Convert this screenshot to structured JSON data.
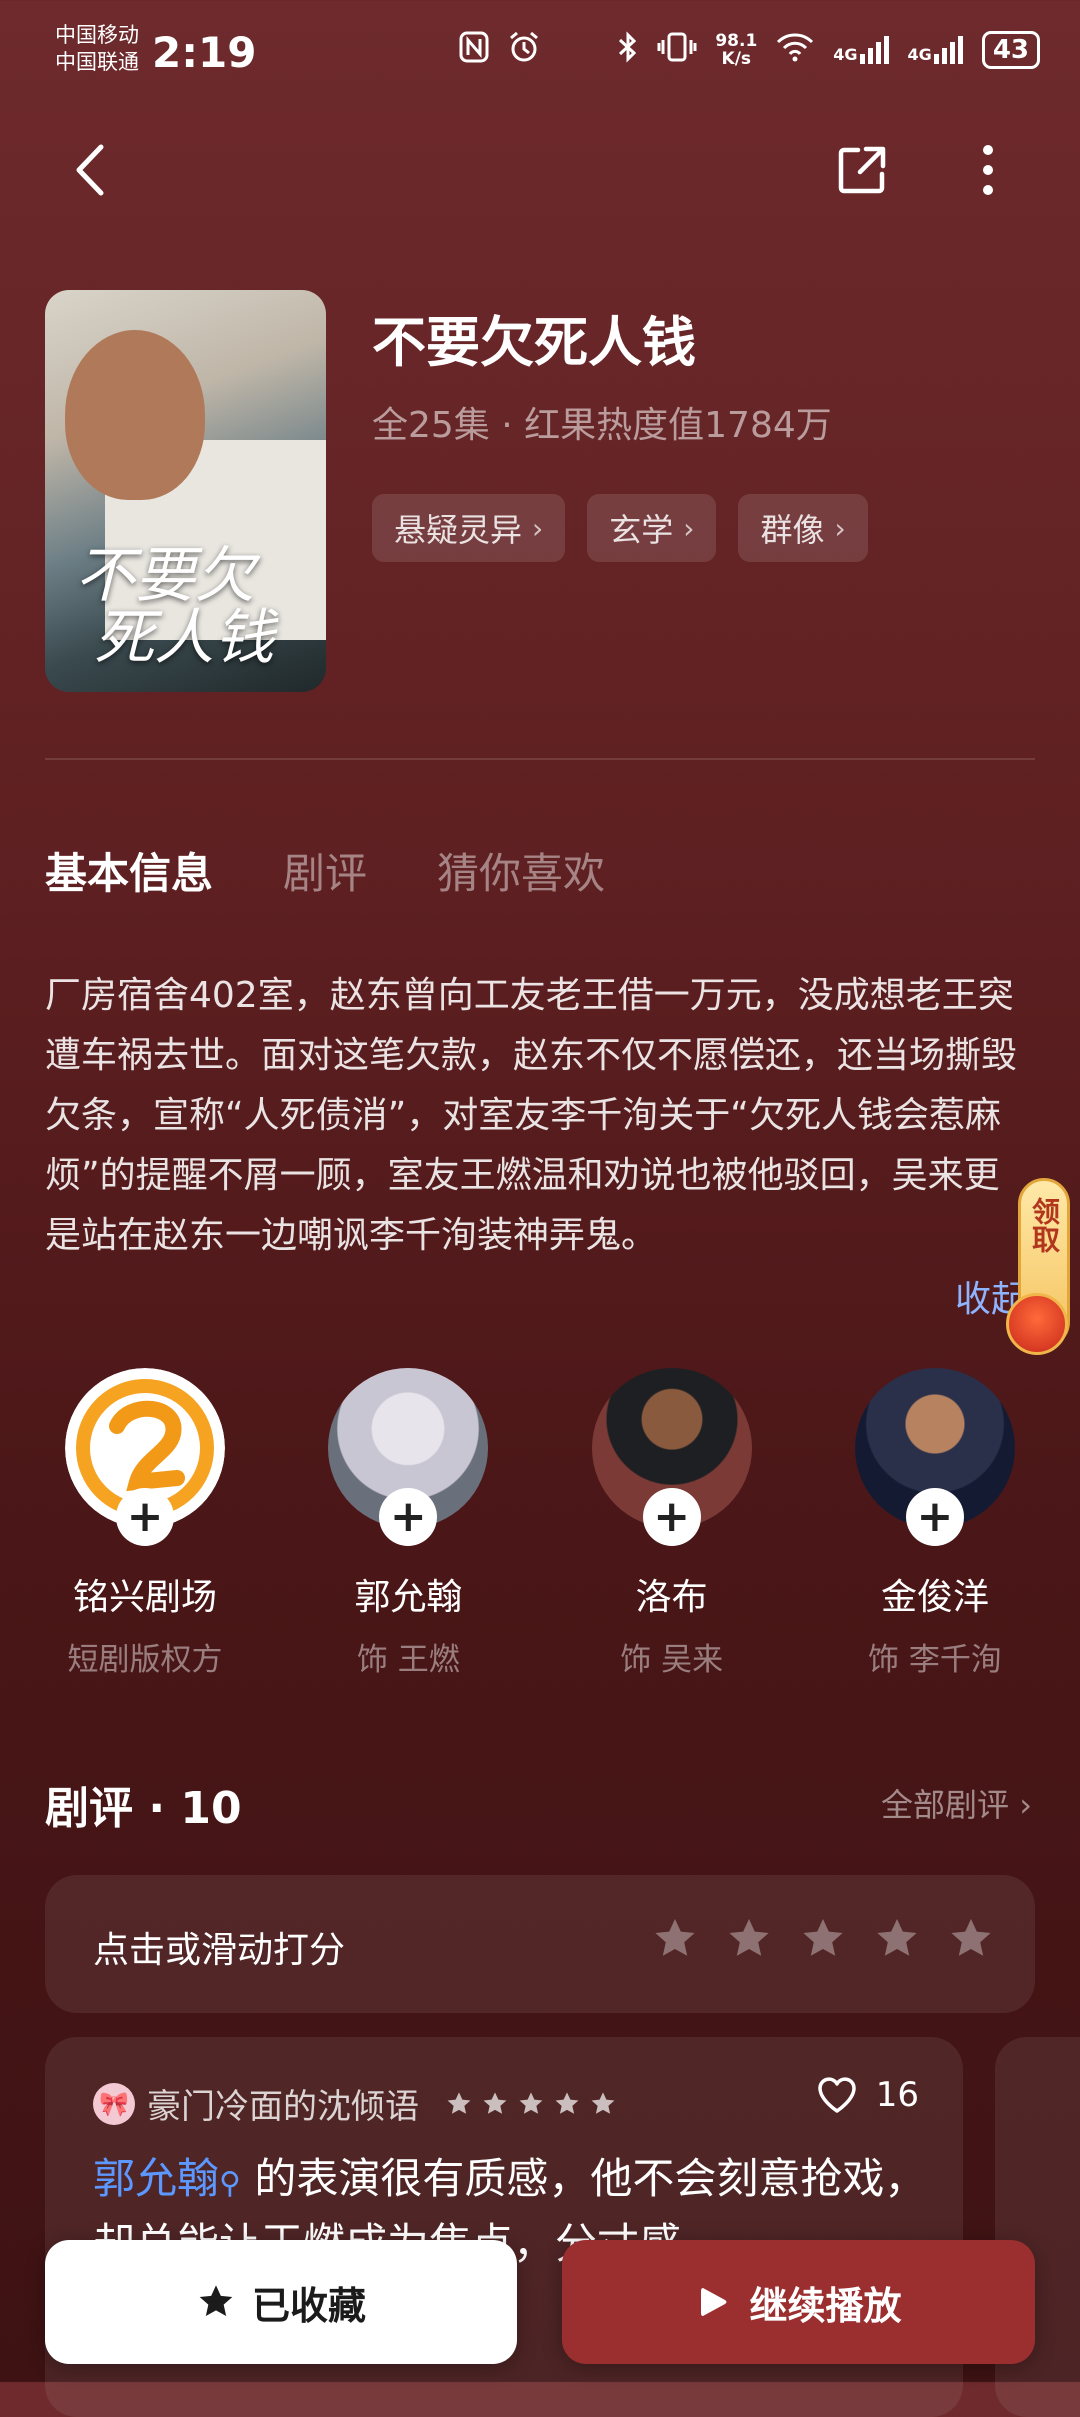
{
  "status_bar": {
    "carrier1": "中国移动",
    "carrier2": "中国联通",
    "time": "2:19",
    "speed_top": "98.1",
    "speed_unit": "K/s",
    "net1": "4G",
    "net2": "4G",
    "battery": "43"
  },
  "header": {
    "title": "不要欠死人钱",
    "poster_title": "不要欠\n死人钱",
    "episodes": "全25集",
    "heat": "红果热度值1784万",
    "tags": [
      "悬疑灵异",
      "玄学",
      "群像"
    ]
  },
  "tabs": [
    "基本信息",
    "剧评",
    "猜你喜欢"
  ],
  "synopsis": "厂房宿舍402室，赵东曾向工友老王借一万元，没成想老王突遭车祸去世。面对这笔欠款，赵东不仅不愿偿还，还当场撕毁欠条，宣称“人死债消”，对室友李千洵关于“欠死人钱会惹麻烦”的提醒不屑一顾，室友王燃温和劝说也被他驳回，吴来更是站在赵东一边嘲讽李千洵装神弄鬼。",
  "collapse_label": "收起",
  "reward_label": "领取",
  "cast": [
    {
      "name": "铭兴剧场",
      "role": "短剧版权方"
    },
    {
      "name": "郭允翰",
      "role": "饰 王燃"
    },
    {
      "name": "洛布",
      "role": "饰 吴来"
    },
    {
      "name": "金俊洋",
      "role": "饰 李千洵"
    }
  ],
  "reviews": {
    "title": "剧评 · 10",
    "all_label": "全部剧评",
    "rate_prompt": "点击或滑动打分",
    "card": {
      "user": "豪门冷面的沈倾语",
      "likes": "16",
      "mention": "郭允翰",
      "text": " 的表演很有质感，他不会刻意抢戏，却总能让王燃成为焦点，分寸感"
    }
  },
  "bottom": {
    "favorite_label": "已收藏",
    "play_label": "继续播放"
  },
  "colors": {
    "background": "#5f2022",
    "play_button": "#9b2e2f",
    "mention": "#5c98ff",
    "collapse": "#8fb4ff"
  }
}
